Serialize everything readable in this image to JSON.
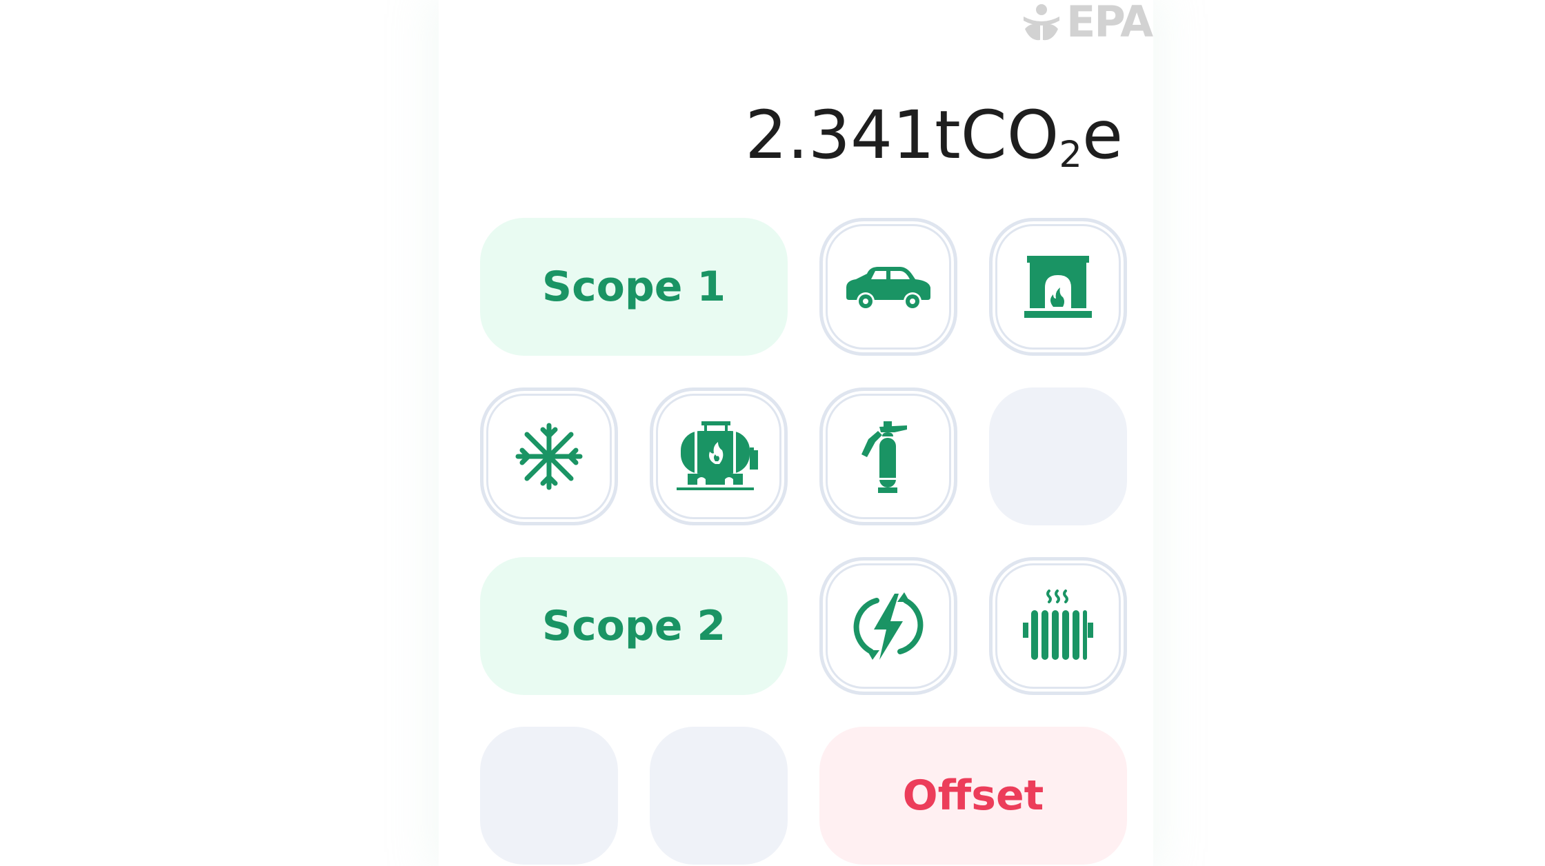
{
  "brand": {
    "logo_text": "EPA",
    "logo_icon": "epa-flower-icon"
  },
  "display": {
    "value": "2.341",
    "unit_prefix": "tCO",
    "unit_subscript": "2",
    "unit_suffix": "e"
  },
  "keypad": {
    "scope1_label": "Scope 1",
    "scope2_label": "Scope 2",
    "offset_label": "Offset",
    "icons": [
      "car-icon",
      "fireplace-icon",
      "snowflake-icon",
      "fuel-tank-icon",
      "fire-extinguisher-icon",
      "electricity-icon",
      "radiator-icon"
    ]
  },
  "colors": {
    "accent_green": "#1a9464",
    "green_key_bg": "#e9fbf2",
    "offset_red": "#ec3d5a",
    "offset_key_bg": "#fff0f2",
    "icon_key_border": "#dfe5ef",
    "blank_key_bg": "#eff2f8",
    "display_text": "#1e1e1e",
    "logo_gray": "#d2d2d2"
  }
}
